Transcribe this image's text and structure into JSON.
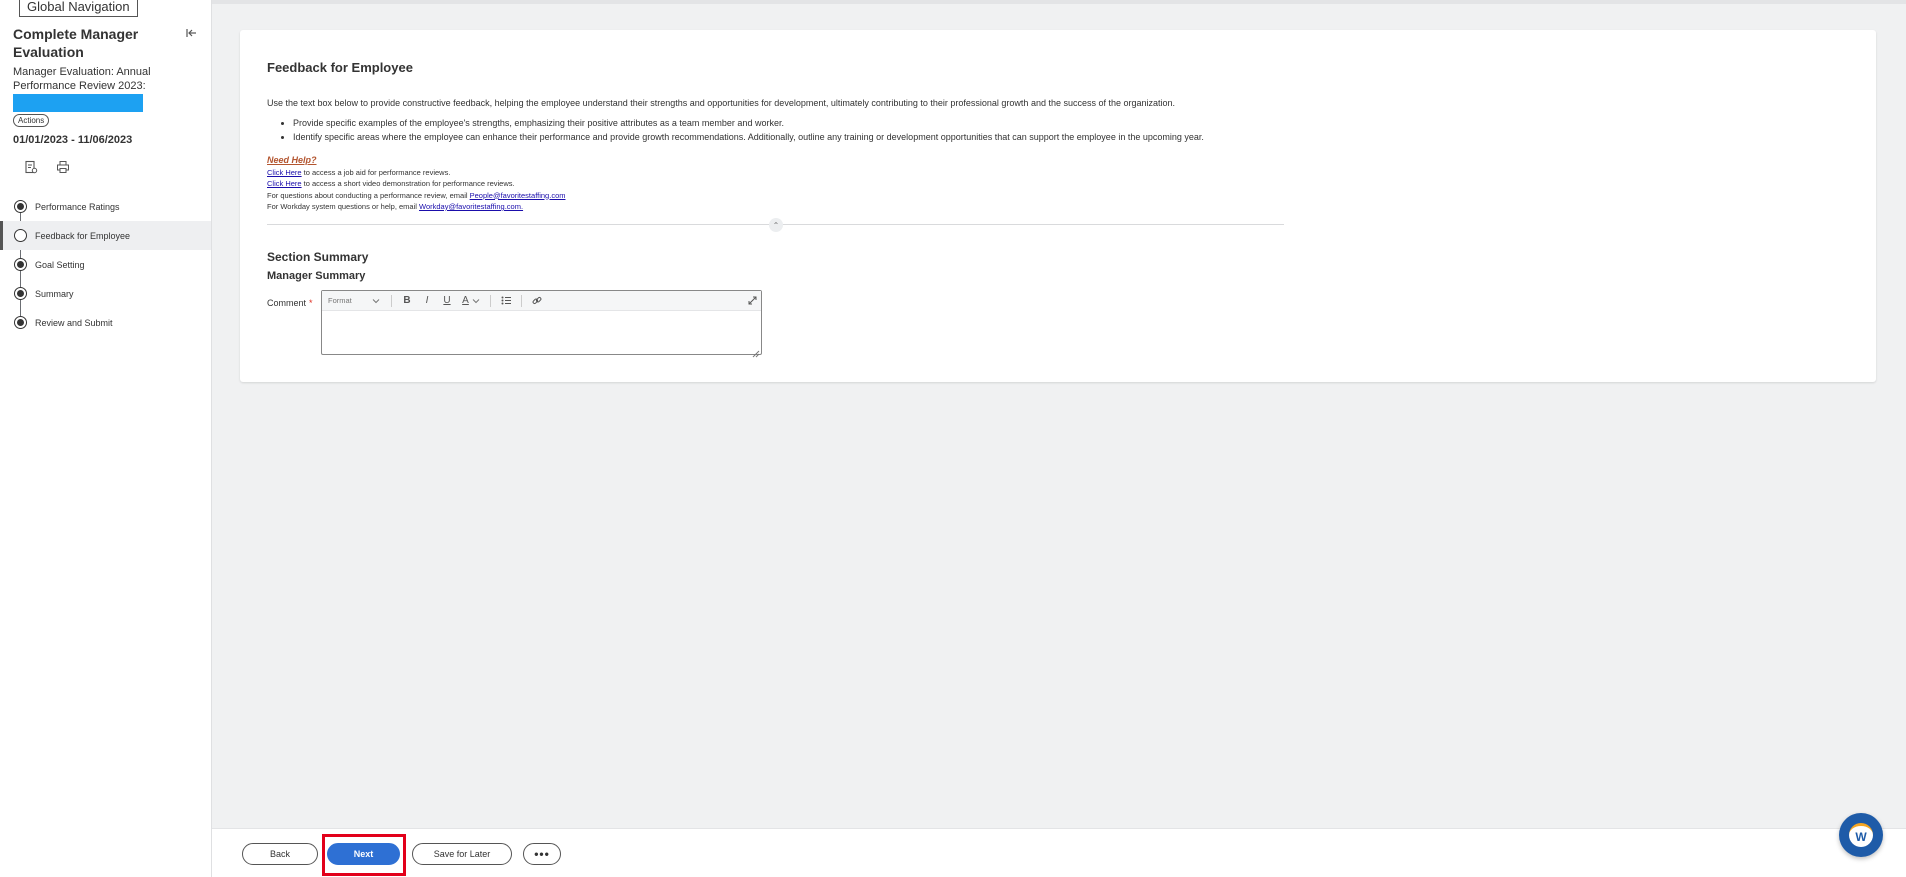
{
  "global_nav": {
    "label": "Global Navigation"
  },
  "sidebar": {
    "title": "Complete Manager Evaluation",
    "subtitle": "Manager Evaluation: Annual Performance Review 2023:",
    "actions_label": "Actions",
    "date_range": "01/01/2023 - 11/06/2023",
    "steps": [
      {
        "label": "Performance Ratings",
        "state": "done"
      },
      {
        "label": "Feedback for Employee",
        "state": "current"
      },
      {
        "label": "Goal Setting",
        "state": "done"
      },
      {
        "label": "Summary",
        "state": "done"
      },
      {
        "label": "Review and Submit",
        "state": "done"
      }
    ]
  },
  "main": {
    "title": "Feedback for Employee",
    "intro": "Use the text box below to provide constructive feedback, helping the employee understand their strengths and opportunities for development, ultimately contributing to their professional growth and the success of the organization.",
    "bullets": [
      "Provide specific examples of the employee's strengths, emphasizing their positive attributes as a team member and worker.",
      "Identify specific areas where the employee can enhance their performance and provide growth recommendations. Additionally, outline any training or development opportunities that can support the employee in the upcoming year."
    ],
    "help": {
      "heading": "Need Help?",
      "link1": "Click Here",
      "line1_rest": " to access a job aid for performance reviews.",
      "link2": "Click Here",
      "line2_rest": " to access a short video demonstration for performance reviews.",
      "line3_pre": "For questions about conducting a performance review, email ",
      "line3_email": "People@favoritestaffing.com",
      "line4_pre": "For Workday system questions or help, email ",
      "line4_email": "Workday@favoritestaffing.com."
    },
    "section_summary": "Section Summary",
    "manager_summary": "Manager Summary",
    "comment_label": "Comment",
    "required_mark": "*",
    "editor": {
      "format_label": "Format",
      "bold": "B",
      "italic": "I",
      "underline": "U",
      "color": "A",
      "value": ""
    }
  },
  "footer": {
    "back": "Back",
    "next": "Next",
    "save_for_later": "Save for Later",
    "more": "•••"
  },
  "chat": {
    "label": "W"
  },
  "colors": {
    "primary": "#2e70d4",
    "highlight": "#e2001a",
    "redaction": "#1da1f2",
    "required": "#de2e21"
  }
}
